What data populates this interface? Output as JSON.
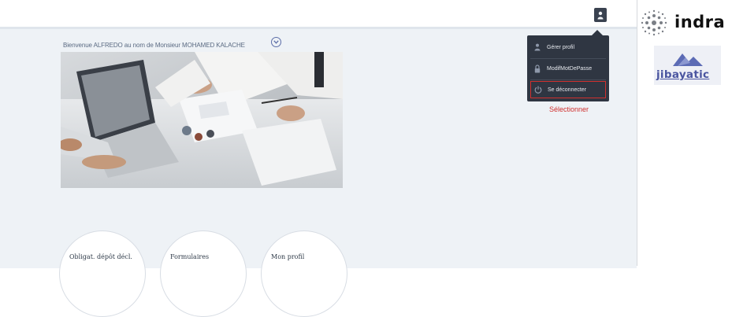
{
  "header": {
    "user_menu_icon": "user-icon"
  },
  "main": {
    "welcome_text": "Bienvenue ALFREDO au nom de Monsieur MOHAMED KALACHE",
    "expand_icon": "chevron-down-icon",
    "tiles": [
      {
        "label": "Obligat. dépôt décl."
      },
      {
        "label": "Formulaires"
      },
      {
        "label": "Mon profil"
      }
    ]
  },
  "user_menu": {
    "items": [
      {
        "label": "Gérer profil",
        "icon": "user-icon"
      },
      {
        "label": "ModifMotDePasse",
        "icon": "lock-icon"
      },
      {
        "label": "Se déconnecter",
        "icon": "power-icon",
        "highlighted": true
      }
    ],
    "annotation": "Sélectionner",
    "highlight_color": "#d0302e"
  },
  "sidebar": {
    "logo_indra": "indra",
    "logo_jibayatic": "jibayatic"
  }
}
